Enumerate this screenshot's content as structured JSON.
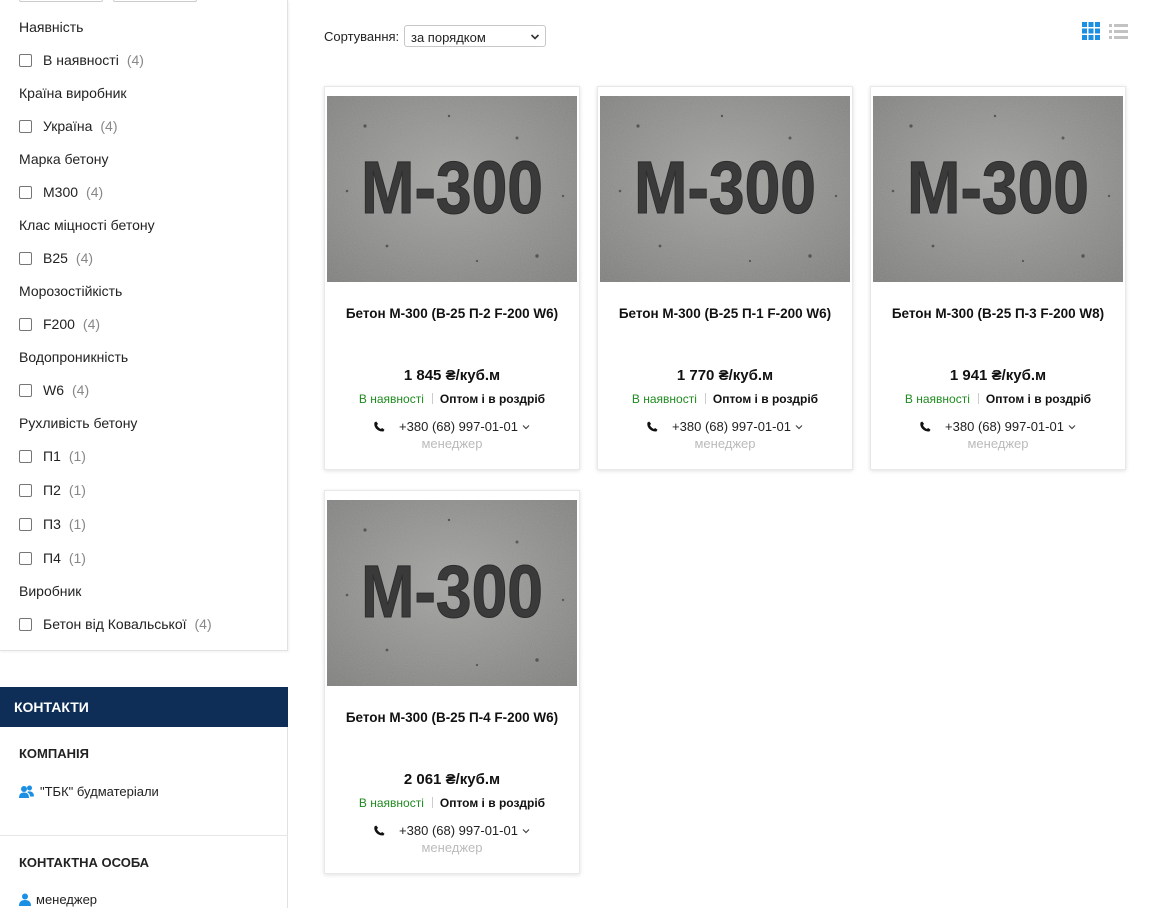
{
  "filters": {
    "groups": [
      {
        "title": "Наявність",
        "options": [
          {
            "label": "В наявності",
            "count": "(4)"
          }
        ]
      },
      {
        "title": "Країна виробник",
        "options": [
          {
            "label": "Україна",
            "count": "(4)"
          }
        ]
      },
      {
        "title": "Марка бетону",
        "options": [
          {
            "label": "М300",
            "count": "(4)"
          }
        ]
      },
      {
        "title": "Клас міцності бетону",
        "options": [
          {
            "label": "B25",
            "count": "(4)"
          }
        ]
      },
      {
        "title": "Морозостійкість",
        "options": [
          {
            "label": "F200",
            "count": "(4)"
          }
        ]
      },
      {
        "title": "Водопроникність",
        "options": [
          {
            "label": "W6",
            "count": "(4)"
          }
        ]
      },
      {
        "title": "Рухливість бетону",
        "options": [
          {
            "label": "П1",
            "count": "(1)"
          },
          {
            "label": "П2",
            "count": "(1)"
          },
          {
            "label": "П3",
            "count": "(1)"
          },
          {
            "label": "П4",
            "count": "(1)"
          }
        ]
      },
      {
        "title": "Виробник",
        "options": [
          {
            "label": "Бетон від Ковальської",
            "count": "(4)"
          }
        ]
      }
    ]
  },
  "contacts": {
    "header": "КОНТАКТИ",
    "company_title": "КОМПАНІЯ",
    "company_name": "\"ТБК\" будматеріали",
    "person_title": "КОНТАКТНА ОСОБА",
    "person_name": "менеджер"
  },
  "toolbar": {
    "sort_label": "Сортування:",
    "sort_value": "за порядком"
  },
  "colors": {
    "accent": "#1a8fe3",
    "contacts_header": "#0e2d57",
    "in_stock": "#1f8a1f"
  },
  "products": [
    {
      "image_text": "М-300",
      "name": "Бетон М-300 (В-25 П-2 F-200 W6)",
      "price": "1 845 ₴/куб.м",
      "stock": "В наявності",
      "wholesale": "Оптом і в роздріб",
      "phone": "+380 (68) 997-01-01",
      "manager": "менеджер"
    },
    {
      "image_text": "М-300",
      "name": "Бетон М-300 (В-25 П-1 F-200 W6)",
      "price": "1 770 ₴/куб.м",
      "stock": "В наявності",
      "wholesale": "Оптом і в роздріб",
      "phone": "+380 (68) 997-01-01",
      "manager": "менеджер"
    },
    {
      "image_text": "М-300",
      "name": "Бетон М-300 (В-25 П-3 F-200 W8)",
      "price": "1 941 ₴/куб.м",
      "stock": "В наявності",
      "wholesale": "Оптом і в роздріб",
      "phone": "+380 (68) 997-01-01",
      "manager": "менеджер"
    },
    {
      "image_text": "М-300",
      "name": "Бетон М-300 (В-25 П-4 F-200 W6)",
      "price": "2 061 ₴/куб.м",
      "stock": "В наявності",
      "wholesale": "Оптом і в роздріб",
      "phone": "+380 (68) 997-01-01",
      "manager": "менеджер"
    }
  ]
}
